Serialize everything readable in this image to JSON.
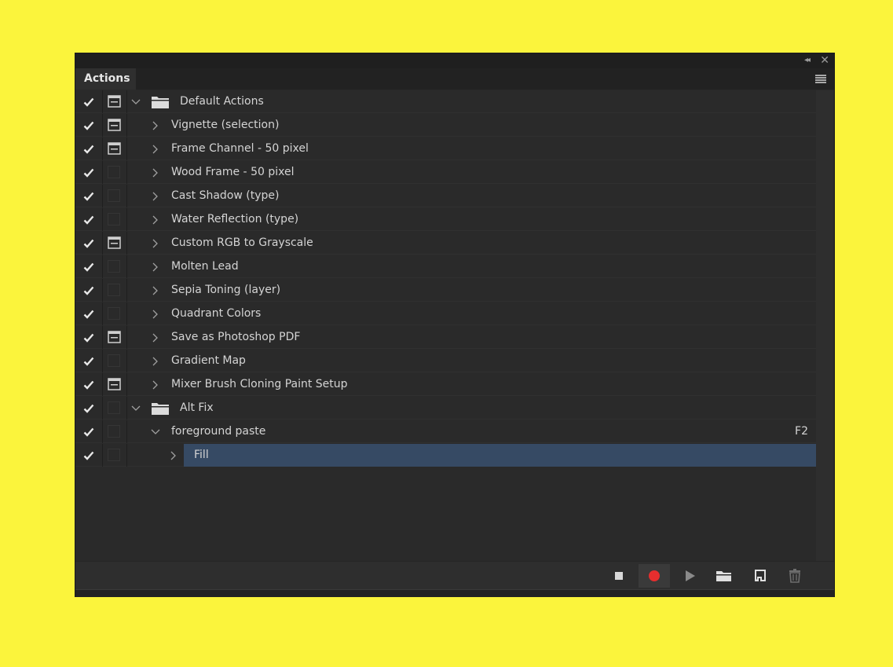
{
  "panel": {
    "tab_label": "Actions",
    "collapse_glyph": "◂◂",
    "close_glyph": "✕"
  },
  "colors": {
    "background": "#fbf43c",
    "panel": "#2a2a2a",
    "selected_row": "#364a64",
    "record_red": "#e62e2e"
  },
  "rows": [
    {
      "label": "Default Actions",
      "checked": true,
      "dialog": true,
      "level": 0,
      "type": "set",
      "expanded": true
    },
    {
      "label": "Vignette (selection)",
      "checked": true,
      "dialog": true,
      "level": 1,
      "type": "action",
      "expanded": false
    },
    {
      "label": "Frame Channel - 50 pixel",
      "checked": true,
      "dialog": true,
      "level": 1,
      "type": "action",
      "expanded": false
    },
    {
      "label": "Wood Frame - 50 pixel",
      "checked": true,
      "dialog": false,
      "level": 1,
      "type": "action",
      "expanded": false
    },
    {
      "label": "Cast Shadow (type)",
      "checked": true,
      "dialog": false,
      "level": 1,
      "type": "action",
      "expanded": false
    },
    {
      "label": "Water Reflection (type)",
      "checked": true,
      "dialog": false,
      "level": 1,
      "type": "action",
      "expanded": false
    },
    {
      "label": "Custom RGB to Grayscale",
      "checked": true,
      "dialog": true,
      "level": 1,
      "type": "action",
      "expanded": false
    },
    {
      "label": "Molten Lead",
      "checked": true,
      "dialog": false,
      "level": 1,
      "type": "action",
      "expanded": false
    },
    {
      "label": "Sepia Toning (layer)",
      "checked": true,
      "dialog": false,
      "level": 1,
      "type": "action",
      "expanded": false
    },
    {
      "label": "Quadrant Colors",
      "checked": true,
      "dialog": false,
      "level": 1,
      "type": "action",
      "expanded": false
    },
    {
      "label": "Save as Photoshop PDF",
      "checked": true,
      "dialog": true,
      "level": 1,
      "type": "action",
      "expanded": false
    },
    {
      "label": "Gradient Map",
      "checked": true,
      "dialog": false,
      "level": 1,
      "type": "action",
      "expanded": false
    },
    {
      "label": "Mixer Brush Cloning Paint Setup",
      "checked": true,
      "dialog": true,
      "level": 1,
      "type": "action",
      "expanded": false
    },
    {
      "label": "Alt Fix",
      "checked": true,
      "dialog": false,
      "level": 0,
      "type": "set",
      "expanded": true
    },
    {
      "label": "foreground paste",
      "checked": true,
      "dialog": false,
      "level": 1,
      "type": "action",
      "expanded": true,
      "shortcut": "F2"
    },
    {
      "label": "Fill",
      "checked": true,
      "dialog": false,
      "level": 2,
      "type": "command",
      "expanded": false,
      "selected": true
    }
  ],
  "toolbar": {
    "buttons": [
      "stop-icon",
      "record-icon",
      "play-icon",
      "folder-icon",
      "new-action-icon",
      "trash-icon"
    ]
  }
}
